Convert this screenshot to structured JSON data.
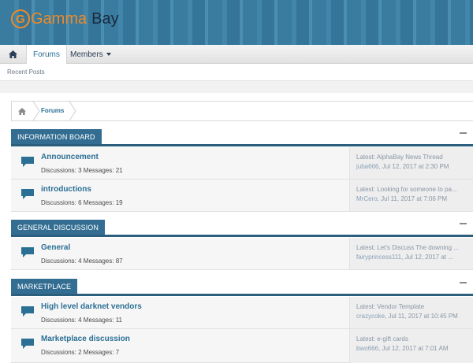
{
  "site": {
    "logo_letter": "G",
    "logo_gamma": "Gamma",
    "logo_bay": "Bay"
  },
  "nav": {
    "forums_label": "Forums",
    "members_label": "Members",
    "recent_posts_label": "Recent Posts"
  },
  "breadcrumb": {
    "forums_label": "Forums"
  },
  "sections": [
    {
      "title": "INFORMATION BOARD",
      "forums": [
        {
          "title": "Announcement",
          "stats": "Discussions: 3 Messages: 21",
          "latest_label": "Latest:",
          "latest_thread": "AlphaBay News Thread",
          "latest_user": "juba666",
          "latest_date": ", Jul 12, 2017 at 2:30 PM"
        },
        {
          "title": "introductions",
          "stats": "Discussions: 6 Messages: 19",
          "latest_label": "Latest:",
          "latest_thread": "Looking for someone to pa...",
          "latest_user": "MrCero",
          "latest_date": ", Jul 11, 2017 at 7:06 PM"
        }
      ]
    },
    {
      "title": "GENERAL DISCUSSION",
      "forums": [
        {
          "title": "General",
          "stats": "Discussions: 4 Messages: 87",
          "latest_label": "Latest:",
          "latest_thread": "Let's Discuss The downing ...",
          "latest_user": "fairyprincess111",
          "latest_date": ", Jul 12, 2017 at ..."
        }
      ]
    },
    {
      "title": "MARKETPLACE",
      "forums": [
        {
          "title": "High level darknet vendors",
          "stats": "Discussions: 4 Messages: 11",
          "latest_label": "Latest:",
          "latest_thread": "Vendor Template",
          "latest_user": "crazycoke",
          "latest_date": ", Jul 11, 2017 at 10:45 PM"
        },
        {
          "title": "Marketplace discussion",
          "stats": "Discussions: 2 Messages: 7",
          "latest_label": "Latest:",
          "latest_thread": "e-gift cards",
          "latest_user": "bwo666",
          "latest_date": ", Jul 12, 2017 at 7:01 AM"
        }
      ]
    }
  ],
  "colors": {
    "accent": "#2b6f95",
    "section_header": "#336e92",
    "logo_orange": "#f08a24"
  }
}
